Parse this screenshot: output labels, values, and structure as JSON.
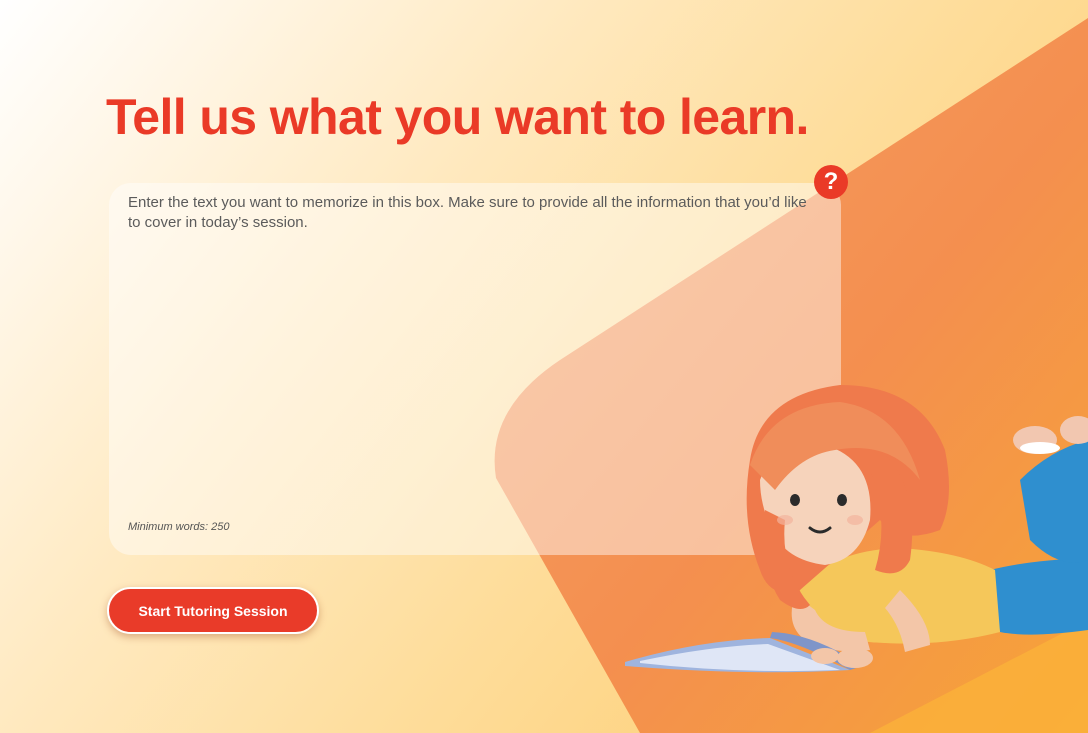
{
  "page": {
    "headline": "Tell us what you want to learn.",
    "help_icon": "?",
    "input": {
      "placeholder": "Enter the text you want to memorize in this box. Make sure to provide all the information that you’d like to cover in today’s session.",
      "value": ""
    },
    "min_words_label": "Minimum words: 250",
    "start_button_label": "Start Tutoring Session"
  },
  "icons": {
    "help": "question-mark-icon",
    "illustration": "girl-reading-book-illustration"
  },
  "colors": {
    "accent": "#ea3a27",
    "background_light": "#fff6e6",
    "background_warm": "#fcc768",
    "shape_orange": "#f4914f",
    "button": "#e93b29",
    "button_text": "#ffffff"
  }
}
